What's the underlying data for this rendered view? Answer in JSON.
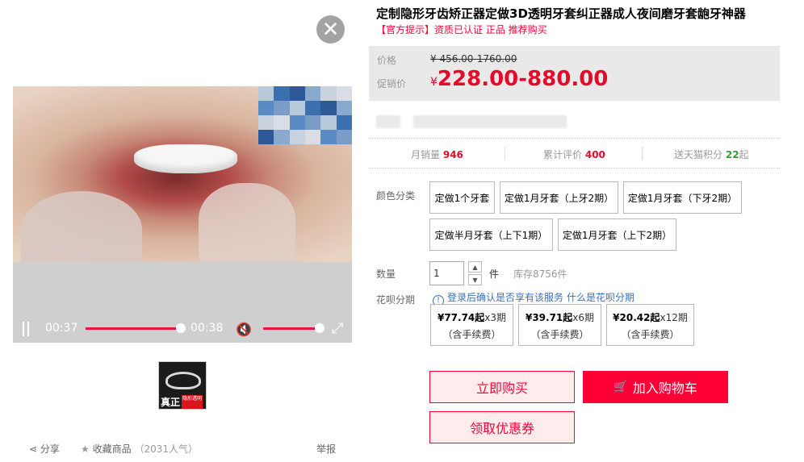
{
  "video": {
    "close_symbol": "✕",
    "time_current": "00:37",
    "time_duration": "00:38",
    "progress": 1.0,
    "volume": 1.0,
    "icons": [
      "close-icon",
      "pause-icon",
      "mute-icon",
      "fullscreen-icon"
    ]
  },
  "thumbnail": {
    "caption_main": "真正",
    "caption_sub": "隐形透明"
  },
  "bottom_links": {
    "share": "分享",
    "favorite": "收藏商品",
    "popularity": "（2031人气）",
    "report": "举报"
  },
  "product": {
    "title": "定制隐形牙齿矫正器定做3D透明牙套纠正器成人夜间磨牙套龅牙神器",
    "notice_tag": "【官方提示】",
    "notice_text": "资质已认证 正品 推荐购买"
  },
  "price": {
    "label_original": "价格",
    "original": "¥ 456.00-1760.00",
    "label_promo": "促销价",
    "currency": "¥",
    "promo": "228.00-880.00"
  },
  "stats": {
    "monthly_label": "月销量",
    "monthly_value": "946",
    "reviews_label": "累计评价",
    "reviews_value": "400",
    "points_label": "送天猫积分",
    "points_value": "22",
    "points_suffix": "起"
  },
  "color": {
    "label": "颜色分类",
    "options": [
      "定做1个牙套",
      "定做1月牙套（上牙2期）",
      "定做1月牙套（下牙2期）",
      "定做半月牙套（上下1期）",
      "定做1月牙套（上下2期）"
    ]
  },
  "quantity": {
    "label": "数量",
    "value": "1",
    "up": "▲",
    "down": "▼",
    "unit": "件",
    "stock": "库存8756件"
  },
  "installment": {
    "label": "花呗分期",
    "info_icon": "!",
    "info_text": "登录后确认是否享有该服务",
    "info_link": "什么是花呗分期",
    "plans": [
      {
        "amount": "¥77.74起",
        "term": "x3期",
        "fee": "（含手续费）"
      },
      {
        "amount": "¥39.71起",
        "term": "x6期",
        "fee": "（含手续费）"
      },
      {
        "amount": "¥20.42起",
        "term": "x12期",
        "fee": "（含手续费）"
      }
    ]
  },
  "actions": {
    "buy_now": "立即购买",
    "add_cart": "加入购物车",
    "coupon": "领取优惠券"
  },
  "colors": {
    "accent": "#ff0036",
    "price": "#e6092a",
    "link": "#3c6fb4"
  }
}
